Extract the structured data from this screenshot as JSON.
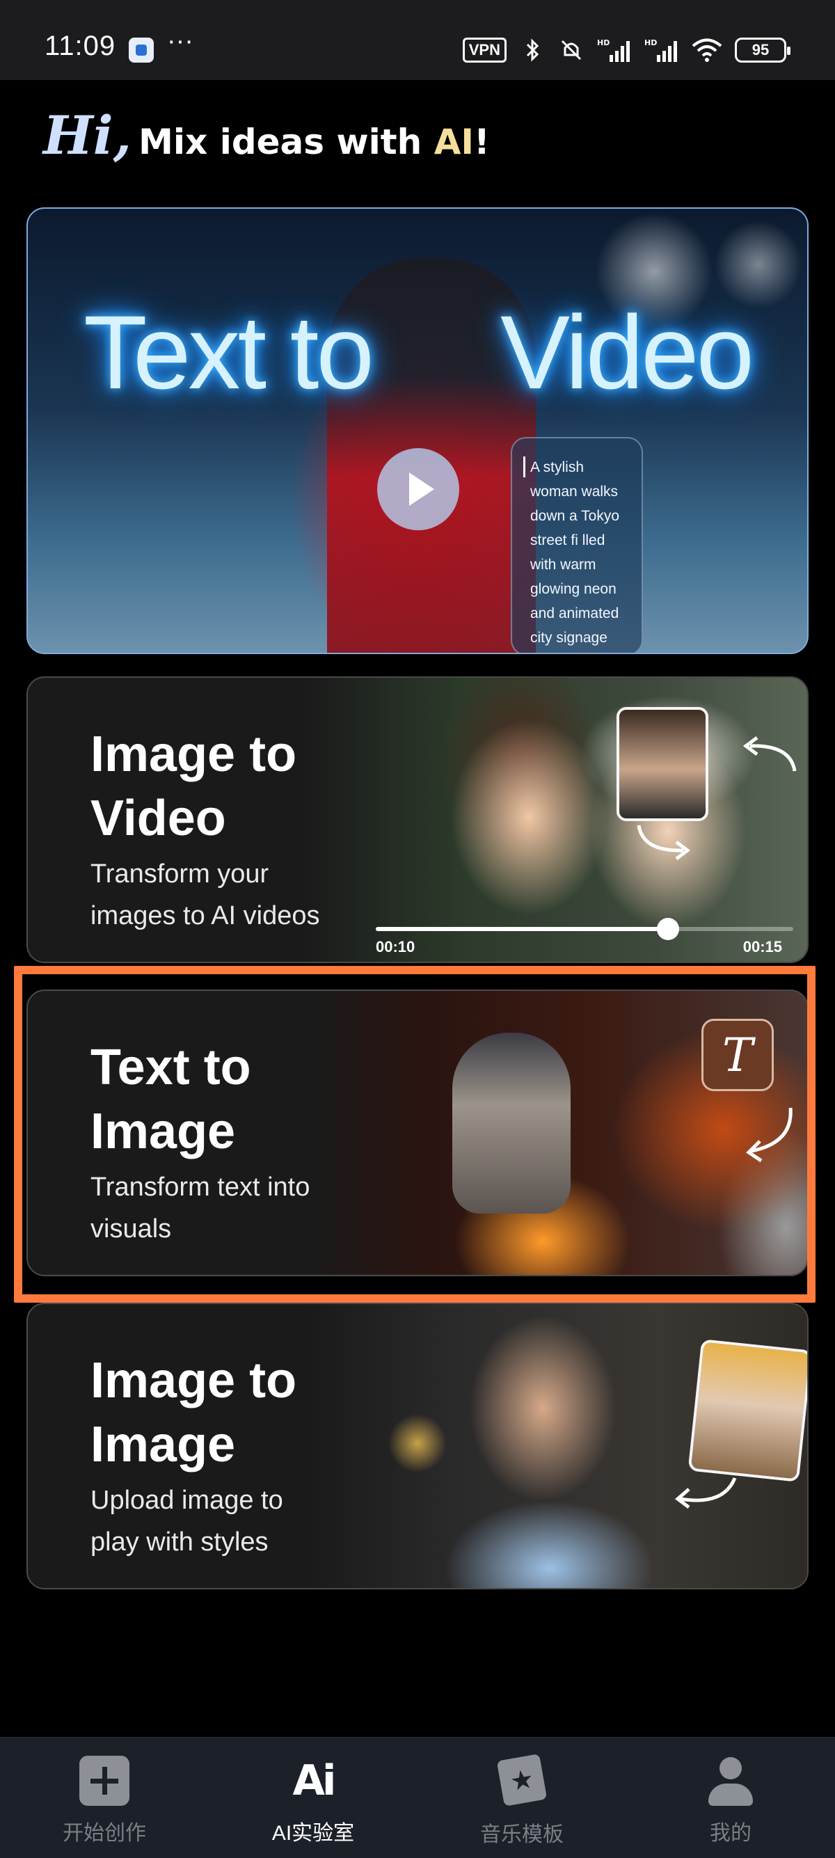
{
  "status_bar": {
    "time": "11:09",
    "dots": "···",
    "vpn_label": "VPN",
    "battery": "95",
    "icons": [
      "app-notification-icon",
      "bluetooth-icon",
      "mute-icon",
      "hd-signal-icon",
      "hd-signal-icon",
      "wifi-icon",
      "battery-icon"
    ]
  },
  "header": {
    "hi": "Hi,",
    "tagline_prefix": "Mix ideas with ",
    "tagline_ai": "AI",
    "tagline_suffix": "!"
  },
  "hero": {
    "title_left": "Text to",
    "title_right": "Video",
    "prompt": "A stylish woman walks down a Tokyo street fi lled with warm glowing neon and animated city signage"
  },
  "cards": [
    {
      "title_line1": "Image to",
      "title_line2": "Video",
      "subtitle_line1": "Transform your",
      "subtitle_line2": "images to AI videos",
      "time_start": "00:10",
      "time_end": "00:15",
      "progress": 0.7
    },
    {
      "title_line1": "Text to",
      "title_line2": "Image",
      "subtitle_line1": "Transform text into",
      "subtitle_line2": "visuals",
      "badge": "T",
      "selected": true
    },
    {
      "title_line1": "Image to",
      "title_line2": "Image",
      "subtitle_line1": "Upload image to",
      "subtitle_line2": "play with styles"
    }
  ],
  "bottom_nav": {
    "items": [
      {
        "label": "开始创作",
        "icon": "plus-icon",
        "active": false
      },
      {
        "label": "AI实验室",
        "icon": "ai-icon",
        "active": true
      },
      {
        "label": "音乐模板",
        "icon": "music-template-icon",
        "active": false
      },
      {
        "label": "我的",
        "icon": "profile-icon",
        "active": false
      }
    ]
  },
  "colors": {
    "highlight": "#ff7a3c",
    "accent_ai": "#f6df9b",
    "hi_color": "#cfe0ff",
    "nav_inactive": "#7c7e86"
  }
}
